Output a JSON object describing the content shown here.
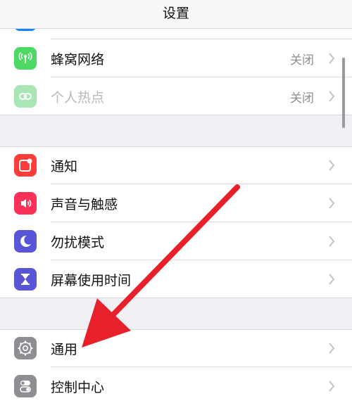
{
  "navbar": {
    "title": "设置"
  },
  "group1": {
    "items": [
      {
        "label": "蜂窝网络",
        "value": "关闭",
        "icon": "cellular-antenna-icon",
        "color": "#4cd964"
      },
      {
        "label": "个人热点",
        "value": "关闭",
        "icon": "personal-hotspot-icon",
        "color": "#a8e6b4"
      }
    ]
  },
  "group2": {
    "items": [
      {
        "label": "通知",
        "icon": "notifications-icon",
        "color": "#fc3d39"
      },
      {
        "label": "声音与触感",
        "icon": "sound-speaker-icon",
        "color": "#fc3158"
      },
      {
        "label": "勿扰模式",
        "icon": "moon-icon",
        "color": "#5856d6"
      },
      {
        "label": "屏幕使用时间",
        "icon": "hourglass-icon",
        "color": "#5856d6"
      }
    ]
  },
  "group3": {
    "items": [
      {
        "label": "通用",
        "icon": "gear-icon",
        "color": "#8e8e93"
      },
      {
        "label": "控制中心",
        "icon": "toggle-switches-icon",
        "color": "#8e8e93"
      }
    ]
  },
  "annotation": {
    "icon": "red-arrow-icon",
    "color": "#e8202a"
  }
}
